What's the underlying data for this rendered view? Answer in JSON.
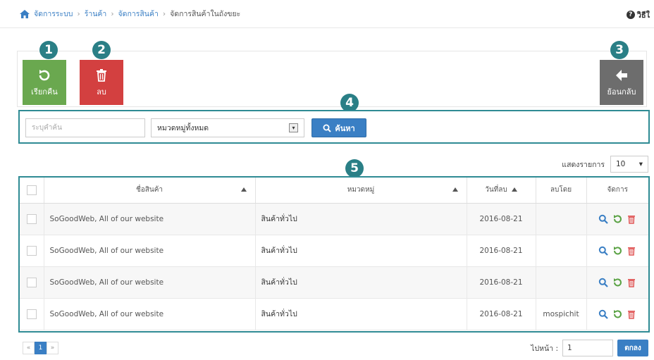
{
  "breadcrumb": {
    "items": [
      "จัดการระบบ",
      "ร้านค้า",
      "จัดการสินค้า"
    ],
    "current": "จัดการสินค้าในถังขยะ"
  },
  "help": {
    "label": "วิธีใ"
  },
  "badges": [
    "1",
    "2",
    "3",
    "4",
    "5"
  ],
  "toolbar": {
    "restore_label": "เรียกคืน",
    "delete_label": "ลบ",
    "back_label": "ย้อนกลับ"
  },
  "search": {
    "placeholder": "ระบุคำค้น",
    "category_value": "หมวดหมู่ทั้งหมด",
    "button_label": "ค้นหา"
  },
  "page_size": {
    "label": "แสดงรายการ",
    "value": "10"
  },
  "table": {
    "headers": {
      "name": "ชื่อสินค้า",
      "category": "หมวดหมู่",
      "date": "วันที่ลบ",
      "deleted_by": "ลบโดย",
      "manage": "จัดการ"
    },
    "rows": [
      {
        "name": "SoGoodWeb, All of our website",
        "category": "สินค้าทั่วไป",
        "date": "2016-08-21",
        "deleted_by": ""
      },
      {
        "name": "SoGoodWeb, All of our website",
        "category": "สินค้าทั่วไป",
        "date": "2016-08-21",
        "deleted_by": ""
      },
      {
        "name": "SoGoodWeb, All of our website",
        "category": "สินค้าทั่วไป",
        "date": "2016-08-21",
        "deleted_by": ""
      },
      {
        "name": "SoGoodWeb, All of our website",
        "category": "สินค้าทั่วไป",
        "date": "2016-08-21",
        "deleted_by": "mospichit"
      }
    ]
  },
  "pagination": {
    "prev": "«",
    "current": "1",
    "next": "»"
  },
  "goto": {
    "label": "ไปหน้า :",
    "value": "1",
    "button_label": "ตกลง"
  },
  "colors": {
    "accent": "#3a7fc4",
    "restore": "#6aa84f",
    "delete": "#d34040",
    "back": "#6d6d6d",
    "badge": "#2a7f86"
  },
  "icons": {
    "home": "home-icon",
    "help": "help-icon",
    "restore": "undo-icon",
    "delete": "trash-icon",
    "back": "arrow-left-icon",
    "search": "search-icon"
  }
}
